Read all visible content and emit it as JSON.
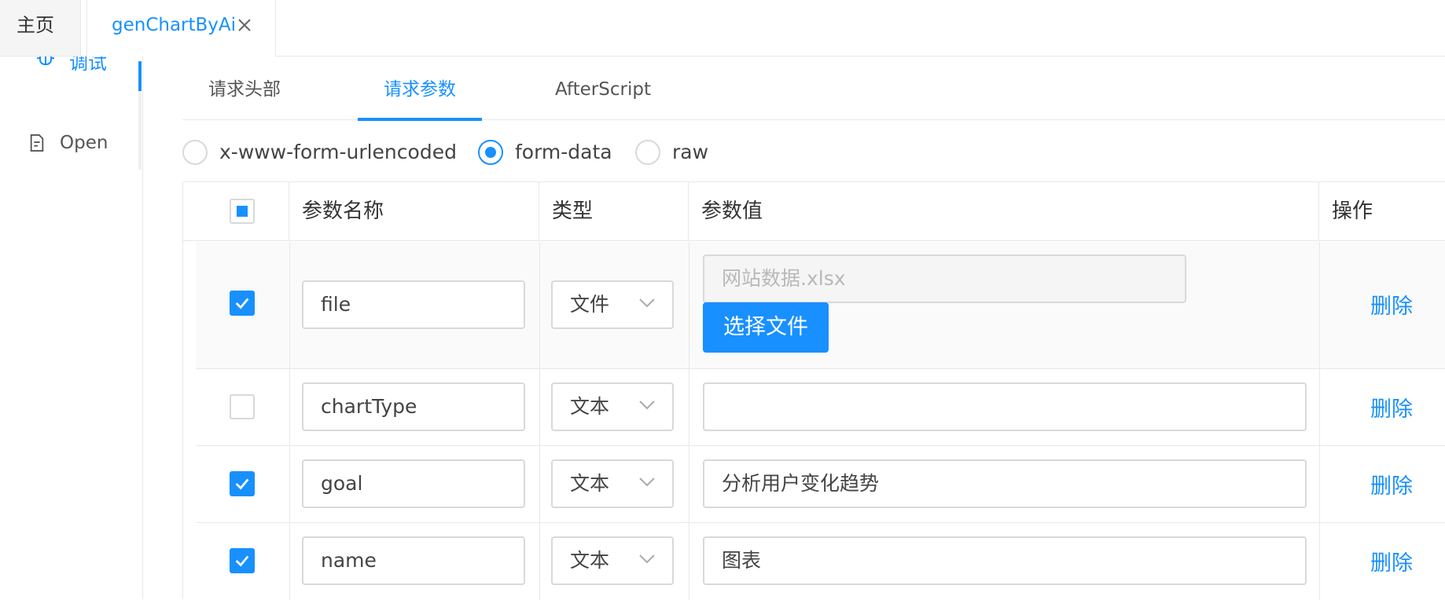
{
  "tabs": {
    "home": "主页",
    "active": "genChartByAi"
  },
  "sidebar": {
    "debug_label": "调试",
    "open_label": "Open"
  },
  "request_tabs": [
    "请求头部",
    "请求参数",
    "AfterScript"
  ],
  "body_types": {
    "options": [
      "x-www-form-urlencoded",
      "form-data",
      "raw"
    ],
    "selected": "form-data"
  },
  "table": {
    "headers": [
      "参数名称",
      "类型",
      "参数值",
      "操作"
    ],
    "rows": [
      {
        "checked": true,
        "name": "file",
        "type": "文件",
        "value": "网站数据.xlsx",
        "file_button": "选择文件",
        "action": "删除"
      },
      {
        "checked": false,
        "name": "chartType",
        "type": "文本",
        "value": "",
        "action": "删除"
      },
      {
        "checked": true,
        "name": "goal",
        "type": "文本",
        "value": "分析用户变化趋势",
        "action": "删除"
      },
      {
        "checked": true,
        "name": "name",
        "type": "文本",
        "value": "图表",
        "action": "删除"
      }
    ]
  },
  "colors": {
    "accent": "#1890ff",
    "border": "#e8e8e8",
    "muted_bg": "#f5f5f5"
  }
}
